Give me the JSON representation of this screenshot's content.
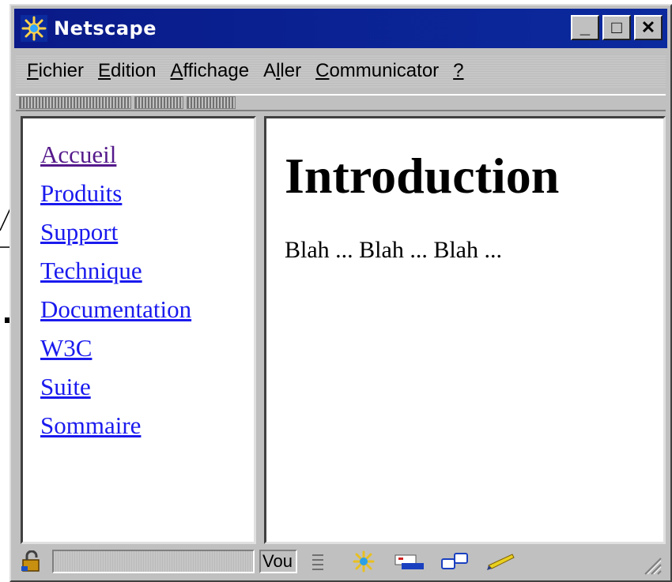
{
  "window": {
    "title": "Netscape",
    "controls": [
      "_",
      "□",
      "✕"
    ]
  },
  "menu": [
    {
      "label": "Fichier",
      "accel": "F"
    },
    {
      "label": "Edition",
      "accel": "E"
    },
    {
      "label": "Affichage",
      "accel": "A"
    },
    {
      "label": "Aller",
      "accel": "l"
    },
    {
      "label": "Communicator",
      "accel": "C"
    },
    {
      "label": "?",
      "accel": "?"
    }
  ],
  "nav": {
    "links": [
      {
        "label": "Accueil",
        "visited": true
      },
      {
        "label": "Produits",
        "visited": false
      },
      {
        "label": "Support",
        "visited": false
      },
      {
        "label": "Technique",
        "visited": false
      },
      {
        "label": "Documentation",
        "visited": false
      },
      {
        "label": "W3C",
        "visited": false
      },
      {
        "label": "Suite",
        "visited": false
      },
      {
        "label": "Sommaire",
        "visited": false
      }
    ]
  },
  "content": {
    "title": "Introduction",
    "text": "Blah ... Blah ... Blah ..."
  },
  "statusbar": {
    "status_text": "Vou",
    "icons": [
      "security-lock-icon",
      "navigator-icon",
      "mail-icon",
      "discussion-icon",
      "composer-icon"
    ]
  },
  "colors": {
    "titlebar": "#0a1a88",
    "link": "#1a1aee",
    "visited_link": "#551a8b",
    "chrome": "#c0c0c0"
  }
}
